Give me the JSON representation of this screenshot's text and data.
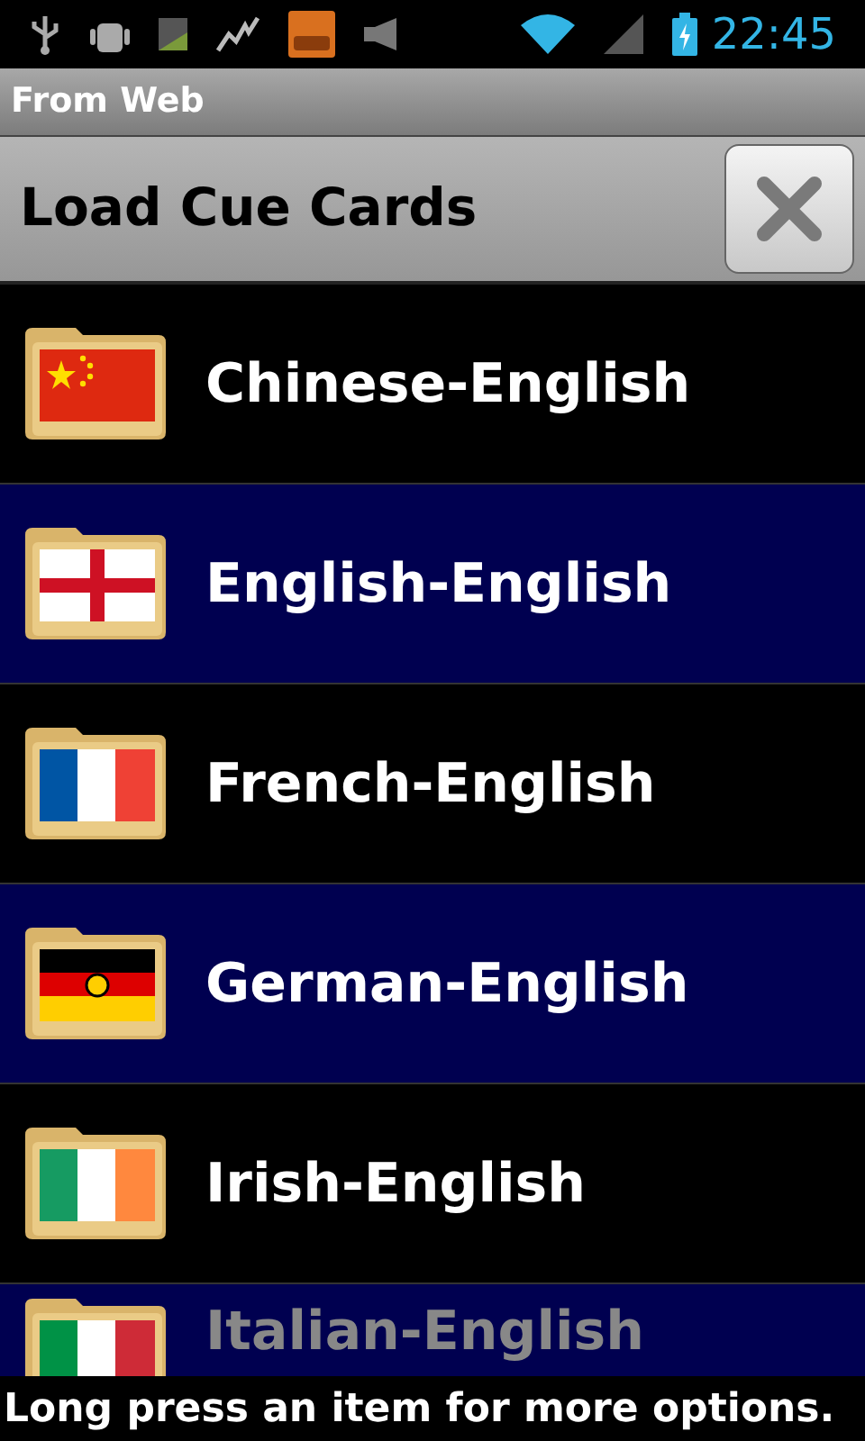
{
  "status_bar": {
    "time": "22:45"
  },
  "title_bar": {
    "title": "From Web"
  },
  "header": {
    "title": "Load Cue Cards"
  },
  "items": [
    {
      "label": "Chinese-English",
      "kind": "cn"
    },
    {
      "label": "English-English",
      "kind": "en"
    },
    {
      "label": "French-English",
      "kind": "fr"
    },
    {
      "label": "German-English",
      "kind": "de"
    },
    {
      "label": "Irish-English",
      "kind": "ie"
    },
    {
      "label": "Italian-English",
      "kind": "it"
    }
  ],
  "footer": {
    "hint": "Long press an item for more options."
  }
}
